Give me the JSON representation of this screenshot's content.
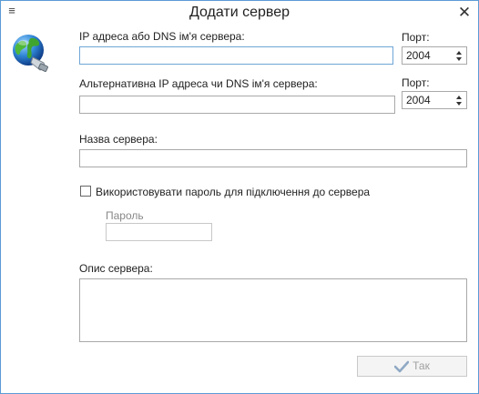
{
  "window": {
    "title": "Додати сервер",
    "menu_icon": "≡",
    "close_icon": "✕"
  },
  "icons": {
    "app": "globe-network-icon",
    "ok": "checkmark-icon"
  },
  "colors": {
    "border": "#5b9bd5",
    "disabled_text": "#a0a0a0",
    "checkmark": "#8fa9c4"
  },
  "form": {
    "address_label": "IP адреса або DNS ім'я сервера:",
    "address_value": "",
    "port_label": "Порт:",
    "port_value": "2004",
    "alt_address_label": "Альтернативна IP адреса чи DNS ім'я сервера:",
    "alt_address_value": "",
    "alt_port_label": "Порт:",
    "alt_port_value": "2004",
    "name_label": "Назва сервера:",
    "name_value": "",
    "use_password_label": "Використовувати пароль для підключення до сервера",
    "use_password_checked": false,
    "password_label": "Пароль",
    "password_value": "",
    "description_label": "Опис сервера:",
    "description_value": ""
  },
  "buttons": {
    "ok_label": "Так"
  }
}
